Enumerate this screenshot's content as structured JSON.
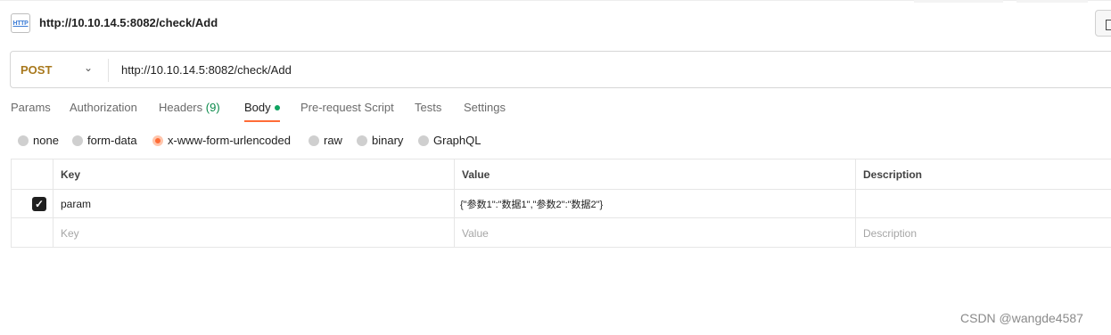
{
  "request": {
    "title": "http://10.10.14.5:8082/check/Add",
    "icon": "http-icon",
    "icon_text": "HTTP",
    "method": "POST",
    "url": "http://10.10.14.5:8082/check/Add"
  },
  "tabs": [
    {
      "label": "Params"
    },
    {
      "label": "Authorization"
    },
    {
      "label": "Headers",
      "count": "(9)"
    },
    {
      "label": "Body",
      "active": true
    },
    {
      "label": "Pre-request Script"
    },
    {
      "label": "Tests"
    },
    {
      "label": "Settings"
    }
  ],
  "body_types": [
    {
      "label": "none"
    },
    {
      "label": "form-data"
    },
    {
      "label": "x-www-form-urlencoded",
      "selected": true
    },
    {
      "label": "raw"
    },
    {
      "label": "binary"
    },
    {
      "label": "GraphQL"
    }
  ],
  "table": {
    "headers": {
      "key": "Key",
      "value": "Value",
      "description": "Description"
    },
    "rows": [
      {
        "checked": true,
        "key": "param",
        "value": "{\"参数1\":\"数据1\",\"参数2\":\"数据2\"}",
        "description": ""
      }
    ],
    "placeholders": {
      "key": "Key",
      "value": "Value",
      "description": "Description"
    }
  },
  "watermark": "CSDN @wangde4587",
  "colors": {
    "accent": "#ff6c37",
    "method": "#a8781c",
    "body_dot": "#0fa360"
  }
}
